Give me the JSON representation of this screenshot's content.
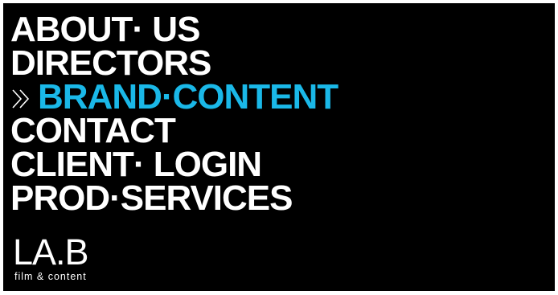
{
  "nav": {
    "items": [
      {
        "label": "ABOUT· US",
        "active": false
      },
      {
        "label": "DIRECTORS",
        "active": false
      },
      {
        "label": "BRAND·CONTENT",
        "active": true
      },
      {
        "label": "CONTACT",
        "active": false
      },
      {
        "label": "CLIENT· LOGIN",
        "active": false
      },
      {
        "label": "PROD·SERVICES",
        "active": false
      }
    ],
    "active_marker_icon": "double-chevron-right-icon"
  },
  "logo": {
    "mark": "LA.B",
    "tagline": "film & content"
  },
  "colors": {
    "background": "#000000",
    "text": "#ffffff",
    "accent": "#1ab8e8"
  }
}
